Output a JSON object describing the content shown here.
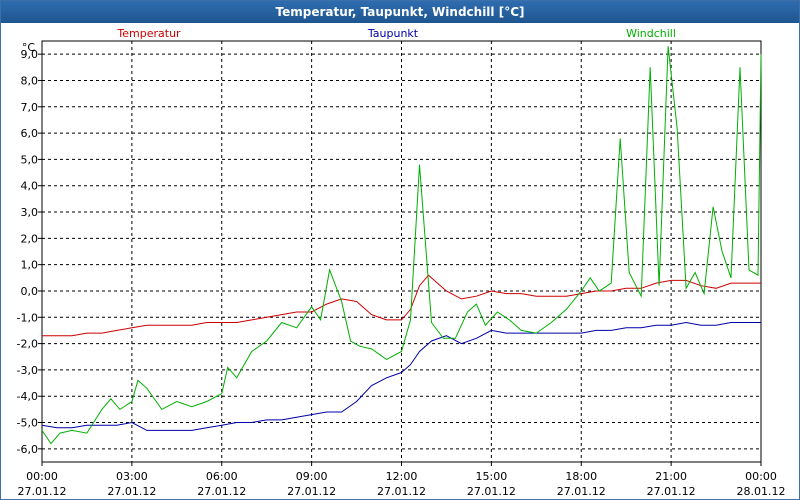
{
  "window": {
    "title": "Temperatur, Taupunkt, Windchill [°C]"
  },
  "chart_data": {
    "type": "line",
    "ylabel": "°C",
    "ylim": [
      -6.5,
      9.5
    ],
    "yticks": [
      "9,0",
      "8,0",
      "7,0",
      "6,0",
      "5,0",
      "4,0",
      "3,0",
      "2,0",
      "1,0",
      "0,0",
      "-1,0",
      "-2,0",
      "-3,0",
      "-4,0",
      "-5,0",
      "-6,0"
    ],
    "ytick_values": [
      9,
      8,
      7,
      6,
      5,
      4,
      3,
      2,
      1,
      0,
      -1,
      -2,
      -3,
      -4,
      -5,
      -6
    ],
    "xlim": [
      0,
      24
    ],
    "xticks": [
      {
        "time": "00:00",
        "date": "27.01.12",
        "h": 0
      },
      {
        "time": "03:00",
        "date": "27.01.12",
        "h": 3
      },
      {
        "time": "06:00",
        "date": "27.01.12",
        "h": 6
      },
      {
        "time": "09:00",
        "date": "27.01.12",
        "h": 9
      },
      {
        "time": "12:00",
        "date": "27.01.12",
        "h": 12
      },
      {
        "time": "15:00",
        "date": "27.01.12",
        "h": 15
      },
      {
        "time": "18:00",
        "date": "27.01.12",
        "h": 18
      },
      {
        "time": "21:00",
        "date": "27.01.12",
        "h": 21
      },
      {
        "time": "00:00",
        "date": "28.01.12",
        "h": 24
      }
    ],
    "grid": true,
    "legend_position": "top",
    "series": [
      {
        "name": "Temperatur",
        "color": "#cc0000",
        "points": [
          [
            0,
            -1.7
          ],
          [
            0.5,
            -1.7
          ],
          [
            1,
            -1.7
          ],
          [
            1.5,
            -1.6
          ],
          [
            2,
            -1.6
          ],
          [
            2.5,
            -1.5
          ],
          [
            3,
            -1.4
          ],
          [
            3.5,
            -1.3
          ],
          [
            4,
            -1.3
          ],
          [
            4.5,
            -1.3
          ],
          [
            5,
            -1.3
          ],
          [
            5.5,
            -1.2
          ],
          [
            6,
            -1.2
          ],
          [
            6.5,
            -1.2
          ],
          [
            7,
            -1.1
          ],
          [
            7.5,
            -1.0
          ],
          [
            8,
            -0.9
          ],
          [
            8.5,
            -0.8
          ],
          [
            9,
            -0.8
          ],
          [
            9.5,
            -0.5
          ],
          [
            10,
            -0.3
          ],
          [
            10.5,
            -0.4
          ],
          [
            11,
            -0.9
          ],
          [
            11.5,
            -1.1
          ],
          [
            12,
            -1.1
          ],
          [
            12.3,
            -0.7
          ],
          [
            12.6,
            0.2
          ],
          [
            12.9,
            0.6
          ],
          [
            13.2,
            0.3
          ],
          [
            13.5,
            0.0
          ],
          [
            14,
            -0.3
          ],
          [
            14.5,
            -0.2
          ],
          [
            15,
            0.0
          ],
          [
            15.5,
            -0.1
          ],
          [
            16,
            -0.1
          ],
          [
            16.5,
            -0.2
          ],
          [
            17,
            -0.2
          ],
          [
            17.5,
            -0.2
          ],
          [
            18,
            -0.1
          ],
          [
            18.5,
            0.0
          ],
          [
            19,
            0.0
          ],
          [
            19.5,
            0.1
          ],
          [
            20,
            0.1
          ],
          [
            20.5,
            0.3
          ],
          [
            21,
            0.4
          ],
          [
            21.5,
            0.4
          ],
          [
            22,
            0.2
          ],
          [
            22.5,
            0.1
          ],
          [
            23,
            0.3
          ],
          [
            23.5,
            0.3
          ],
          [
            24,
            0.3
          ]
        ]
      },
      {
        "name": "Taupunkt",
        "color": "#0000aa",
        "points": [
          [
            0,
            -5.1
          ],
          [
            0.5,
            -5.2
          ],
          [
            1,
            -5.2
          ],
          [
            1.5,
            -5.1
          ],
          [
            2,
            -5.1
          ],
          [
            2.5,
            -5.1
          ],
          [
            3,
            -5.0
          ],
          [
            3.5,
            -5.3
          ],
          [
            4,
            -5.3
          ],
          [
            4.5,
            -5.3
          ],
          [
            5,
            -5.3
          ],
          [
            5.5,
            -5.2
          ],
          [
            6,
            -5.1
          ],
          [
            6.5,
            -5.0
          ],
          [
            7,
            -5.0
          ],
          [
            7.5,
            -4.9
          ],
          [
            8,
            -4.9
          ],
          [
            8.5,
            -4.8
          ],
          [
            9,
            -4.7
          ],
          [
            9.5,
            -4.6
          ],
          [
            10,
            -4.6
          ],
          [
            10.5,
            -4.2
          ],
          [
            11,
            -3.6
          ],
          [
            11.5,
            -3.3
          ],
          [
            12,
            -3.1
          ],
          [
            12.3,
            -2.8
          ],
          [
            12.6,
            -2.3
          ],
          [
            13,
            -1.9
          ],
          [
            13.5,
            -1.7
          ],
          [
            14,
            -2.0
          ],
          [
            14.5,
            -1.8
          ],
          [
            15,
            -1.5
          ],
          [
            15.5,
            -1.6
          ],
          [
            16,
            -1.6
          ],
          [
            16.5,
            -1.6
          ],
          [
            17,
            -1.6
          ],
          [
            17.5,
            -1.6
          ],
          [
            18,
            -1.6
          ],
          [
            18.5,
            -1.5
          ],
          [
            19,
            -1.5
          ],
          [
            19.5,
            -1.4
          ],
          [
            20,
            -1.4
          ],
          [
            20.5,
            -1.3
          ],
          [
            21,
            -1.3
          ],
          [
            21.5,
            -1.2
          ],
          [
            22,
            -1.3
          ],
          [
            22.5,
            -1.3
          ],
          [
            23,
            -1.2
          ],
          [
            23.5,
            -1.2
          ],
          [
            24,
            -1.2
          ]
        ]
      },
      {
        "name": "Windchill",
        "color": "#00b000",
        "points": [
          [
            0,
            -5.3
          ],
          [
            0.3,
            -5.8
          ],
          [
            0.6,
            -5.4
          ],
          [
            1,
            -5.3
          ],
          [
            1.5,
            -5.4
          ],
          [
            2,
            -4.5
          ],
          [
            2.3,
            -4.1
          ],
          [
            2.6,
            -4.5
          ],
          [
            3,
            -4.2
          ],
          [
            3.2,
            -3.4
          ],
          [
            3.5,
            -3.7
          ],
          [
            4,
            -4.5
          ],
          [
            4.5,
            -4.2
          ],
          [
            5,
            -4.4
          ],
          [
            5.5,
            -4.2
          ],
          [
            6,
            -3.9
          ],
          [
            6.2,
            -2.9
          ],
          [
            6.5,
            -3.3
          ],
          [
            7,
            -2.3
          ],
          [
            7.5,
            -1.9
          ],
          [
            8,
            -1.2
          ],
          [
            8.5,
            -1.4
          ],
          [
            9,
            -0.6
          ],
          [
            9.3,
            -1.1
          ],
          [
            9.6,
            0.8
          ],
          [
            10,
            -0.4
          ],
          [
            10.3,
            -1.9
          ],
          [
            10.6,
            -2.1
          ],
          [
            11,
            -2.2
          ],
          [
            11.5,
            -2.6
          ],
          [
            12,
            -2.3
          ],
          [
            12.3,
            -1.1
          ],
          [
            12.6,
            4.8
          ],
          [
            13,
            -1.2
          ],
          [
            13.4,
            -1.8
          ],
          [
            13.8,
            -1.8
          ],
          [
            14.2,
            -0.8
          ],
          [
            14.5,
            -0.5
          ],
          [
            14.8,
            -1.3
          ],
          [
            15.2,
            -0.8
          ],
          [
            15.6,
            -1.1
          ],
          [
            16,
            -1.5
          ],
          [
            16.5,
            -1.6
          ],
          [
            17,
            -1.2
          ],
          [
            17.5,
            -0.7
          ],
          [
            18,
            0.0
          ],
          [
            18.3,
            0.5
          ],
          [
            18.6,
            0.0
          ],
          [
            19,
            0.3
          ],
          [
            19.3,
            5.8
          ],
          [
            19.6,
            0.7
          ],
          [
            20,
            -0.2
          ],
          [
            20.3,
            8.5
          ],
          [
            20.6,
            0.2
          ],
          [
            20.9,
            9.3
          ],
          [
            21.2,
            6.2
          ],
          [
            21.5,
            0.1
          ],
          [
            21.8,
            0.7
          ],
          [
            22.1,
            -0.1
          ],
          [
            22.4,
            3.2
          ],
          [
            22.7,
            1.5
          ],
          [
            23,
            0.5
          ],
          [
            23.3,
            8.5
          ],
          [
            23.6,
            0.8
          ],
          [
            23.9,
            0.6
          ],
          [
            24,
            9.0
          ]
        ]
      }
    ]
  }
}
